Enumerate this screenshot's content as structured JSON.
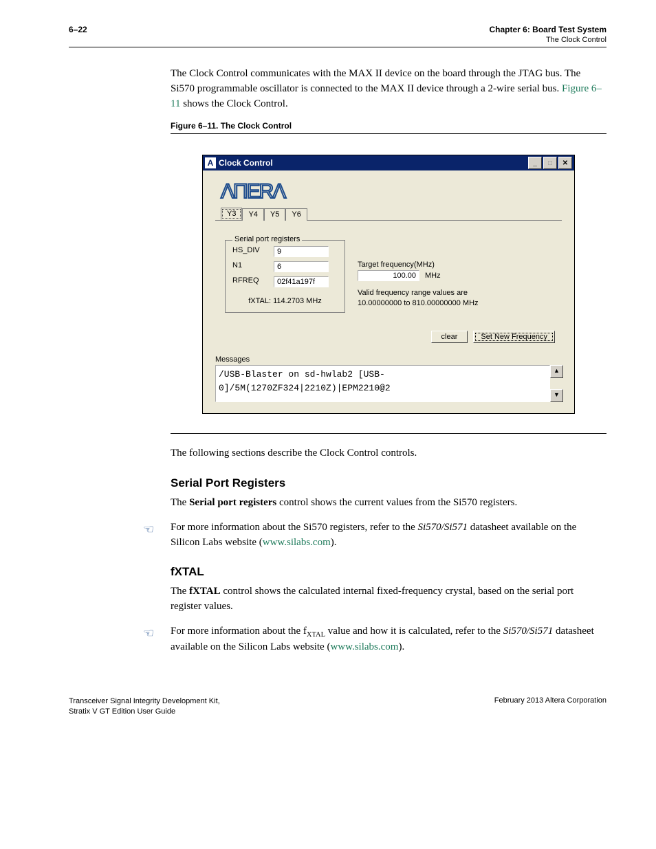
{
  "header": {
    "page_number": "6–22",
    "chapter": "Chapter 6:  Board Test System",
    "section": "The Clock Control"
  },
  "intro_para_1": "The Clock Control communicates with the MAX II device on the board through the JTAG bus. The Si570 programmable oscillator is connected to the MAX II device through a 2-wire serial bus. ",
  "intro_link": "Figure 6–11",
  "intro_para_2": " shows the Clock Control.",
  "figure_caption": "Figure 6–11.  The Clock Control",
  "dialog": {
    "title": "Clock Control",
    "logo": "ΛПΕRΛ",
    "tabs": [
      "Y3",
      "Y4",
      "Y5",
      "Y6"
    ],
    "group_legend": "Serial port registers",
    "registers": {
      "hs_div_label": "HS_DIV",
      "hs_div_value": "9",
      "n1_label": "N1",
      "n1_value": "6",
      "rfreq_label": "RFREQ",
      "rfreq_value": "02f41a197f"
    },
    "fxtal": "fXTAL:  114.2703 MHz",
    "target_label": "Target frequency(MHz)",
    "target_value": "100.00",
    "target_unit": "MHz",
    "range_line1": "Valid frequency range values are",
    "range_line2": "10.00000000 to 810.00000000 MHz",
    "btn_clear": "clear",
    "btn_set": "Set New Frequency",
    "messages_label": "Messages",
    "messages_text": "/USB-Blaster on sd-hwlab2 [USB-0]/5M(1270ZF324|2210Z)|EPM2210@2"
  },
  "post_fig": "The following sections describe the Clock Control controls.",
  "s1": {
    "title": "Serial Port Registers",
    "p1a": "The ",
    "p1b": "Serial port registers",
    "p1c": " control shows the current values from the Si570 registers.",
    "p2a": "For more information about the Si570 registers, refer to the ",
    "p2i": "Si570/Si571",
    "p2b": " datasheet available on the Silicon Labs website (",
    "p2link": "www.silabs.com",
    "p2c": ")."
  },
  "s2": {
    "title": "fXTAL",
    "p1a": "The ",
    "p1b": "fXTAL",
    "p1c": " control shows the calculated internal fixed-frequency crystal, based on the serial port register values.",
    "p2a": "For more information about the f",
    "p2sub": "XTAL",
    "p2b": " value and how it is calculated, refer to the ",
    "p2i": "Si570/Si571",
    "p2c": " datasheet available on the Silicon Labs website (",
    "p2link": "www.silabs.com",
    "p2d": ")."
  },
  "footer": {
    "left1": "Transceiver Signal Integrity Development Kit,",
    "left2": "Stratix V GT Edition User Guide",
    "right": "February 2013    Altera Corporation"
  }
}
